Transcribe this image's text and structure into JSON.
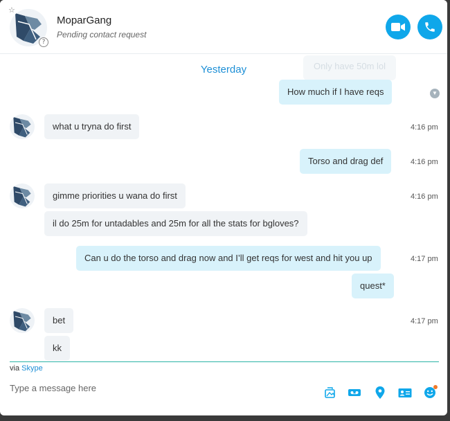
{
  "contact": {
    "name": "MoparGang",
    "status": "Pending contact request"
  },
  "header": {
    "video_call_icon": "video-camera-icon",
    "audio_call_icon": "phone-icon",
    "favorite_icon": "star-outline-icon",
    "help_icon": "question-icon"
  },
  "chat": {
    "day_separator": "Yesterday",
    "ghost_text": "Only have 50m lol",
    "messages": [
      {
        "text": "How much if I have reqs",
        "time": ""
      },
      {
        "text": "what u tryna do first",
        "time": "4:16 pm"
      },
      {
        "text": "Torso and drag def",
        "time": "4:16 pm"
      },
      {
        "text": "gimme priorities u wana do first",
        "time": "4:16 pm"
      },
      {
        "text": "il do 25m for untadables and 25m for all the stats for bgloves?",
        "time": ""
      },
      {
        "text": "Can u do the torso and drag now and I’ll get reqs for west and hit you up",
        "time": "4:17 pm"
      },
      {
        "text": "quest*",
        "time": ""
      },
      {
        "text": "bet",
        "time": "4:17 pm"
      },
      {
        "text": "kk",
        "time": ""
      }
    ]
  },
  "footer": {
    "via_prefix": "via",
    "via_link": "Skype",
    "compose_placeholder": "Type a message here",
    "tools": [
      "media-icon",
      "video-message-icon",
      "location-icon",
      "contact-card-icon",
      "emoji-icon"
    ]
  },
  "colors": {
    "accent": "#0fa7ea",
    "link": "#1d8fd6",
    "incoming_bubble": "#f0f3f6",
    "outgoing_bubble": "#d8f2fb",
    "divider": "#2bb3a6",
    "notification": "#f07a2a"
  }
}
